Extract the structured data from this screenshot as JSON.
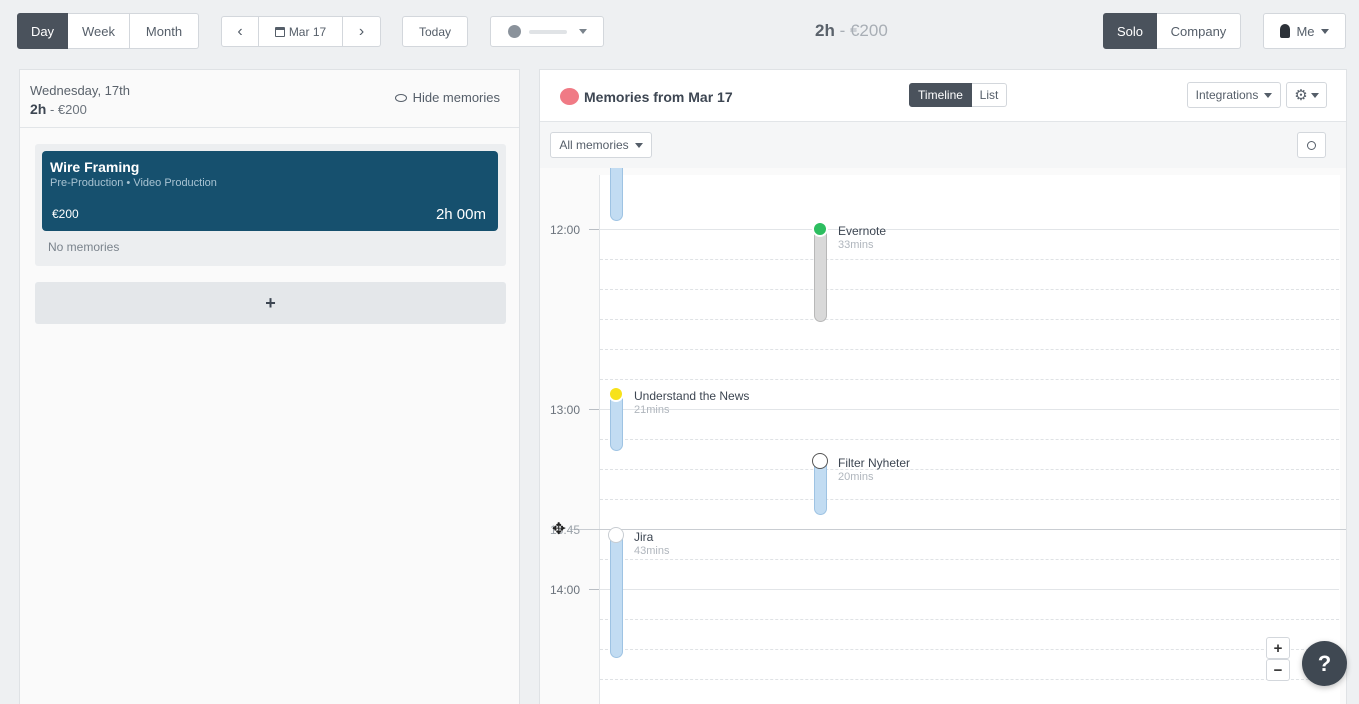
{
  "topbar": {
    "views": [
      "Day",
      "Week",
      "Month"
    ],
    "active_view": "Day",
    "date_label": "Mar 17",
    "today_label": "Today",
    "summary_hours": "2h",
    "summary_sep": " - ",
    "summary_money": "€200",
    "modes": [
      "Solo",
      "Company"
    ],
    "active_mode": "Solo",
    "user_label": "Me"
  },
  "left": {
    "day_label": "Wednesday, 17th",
    "hours": "2h",
    "sep": " - ",
    "money": "€200",
    "hide_memories_label": "Hide memories",
    "entry": {
      "title": "Wire Framing",
      "subtitle": "Pre-Production • Video Production",
      "price": "€200",
      "duration": "2h 00m",
      "color": "#16506e"
    },
    "no_memories": "No memories",
    "add_label": "+"
  },
  "right": {
    "title": "Memories from Mar 17",
    "tabs": [
      "Timeline",
      "List"
    ],
    "active_tab": "Timeline",
    "integrations_label": "Integrations",
    "filter_label": "All memories",
    "hours": [
      "12:00",
      "13:00",
      "13:45",
      "14:00"
    ],
    "memories": [
      {
        "name": "Evernote",
        "duration": "33mins",
        "icon": "evernote-icon"
      },
      {
        "name": "Understand the News",
        "duration": "21mins",
        "icon": "news-icon"
      },
      {
        "name": "Filter Nyheter",
        "duration": "20mins",
        "icon": "chat-icon"
      },
      {
        "name": "Jira",
        "duration": "43mins",
        "icon": "jira-icon"
      }
    ],
    "zoom_in": "+",
    "zoom_out": "−",
    "help": "?"
  }
}
